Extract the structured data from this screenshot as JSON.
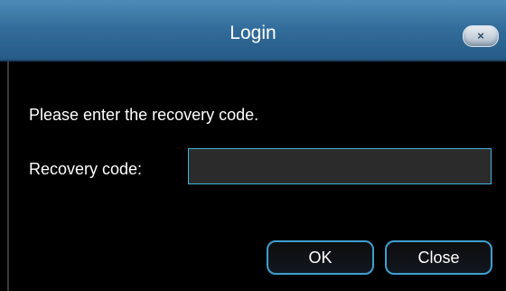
{
  "window": {
    "title": "Login",
    "close_glyph": "×"
  },
  "content": {
    "prompt": "Please enter the recovery code.",
    "recovery_label": "Recovery code:",
    "recovery_value": "",
    "recovery_placeholder": ""
  },
  "buttons": {
    "ok_label": "OK",
    "close_label": "Close"
  },
  "colors": {
    "title_bar": "#336d9b",
    "accent_border": "#3fb7de",
    "background": "#000000",
    "input_background": "#2b2b2b"
  },
  "icons": {
    "close": "close-icon"
  }
}
